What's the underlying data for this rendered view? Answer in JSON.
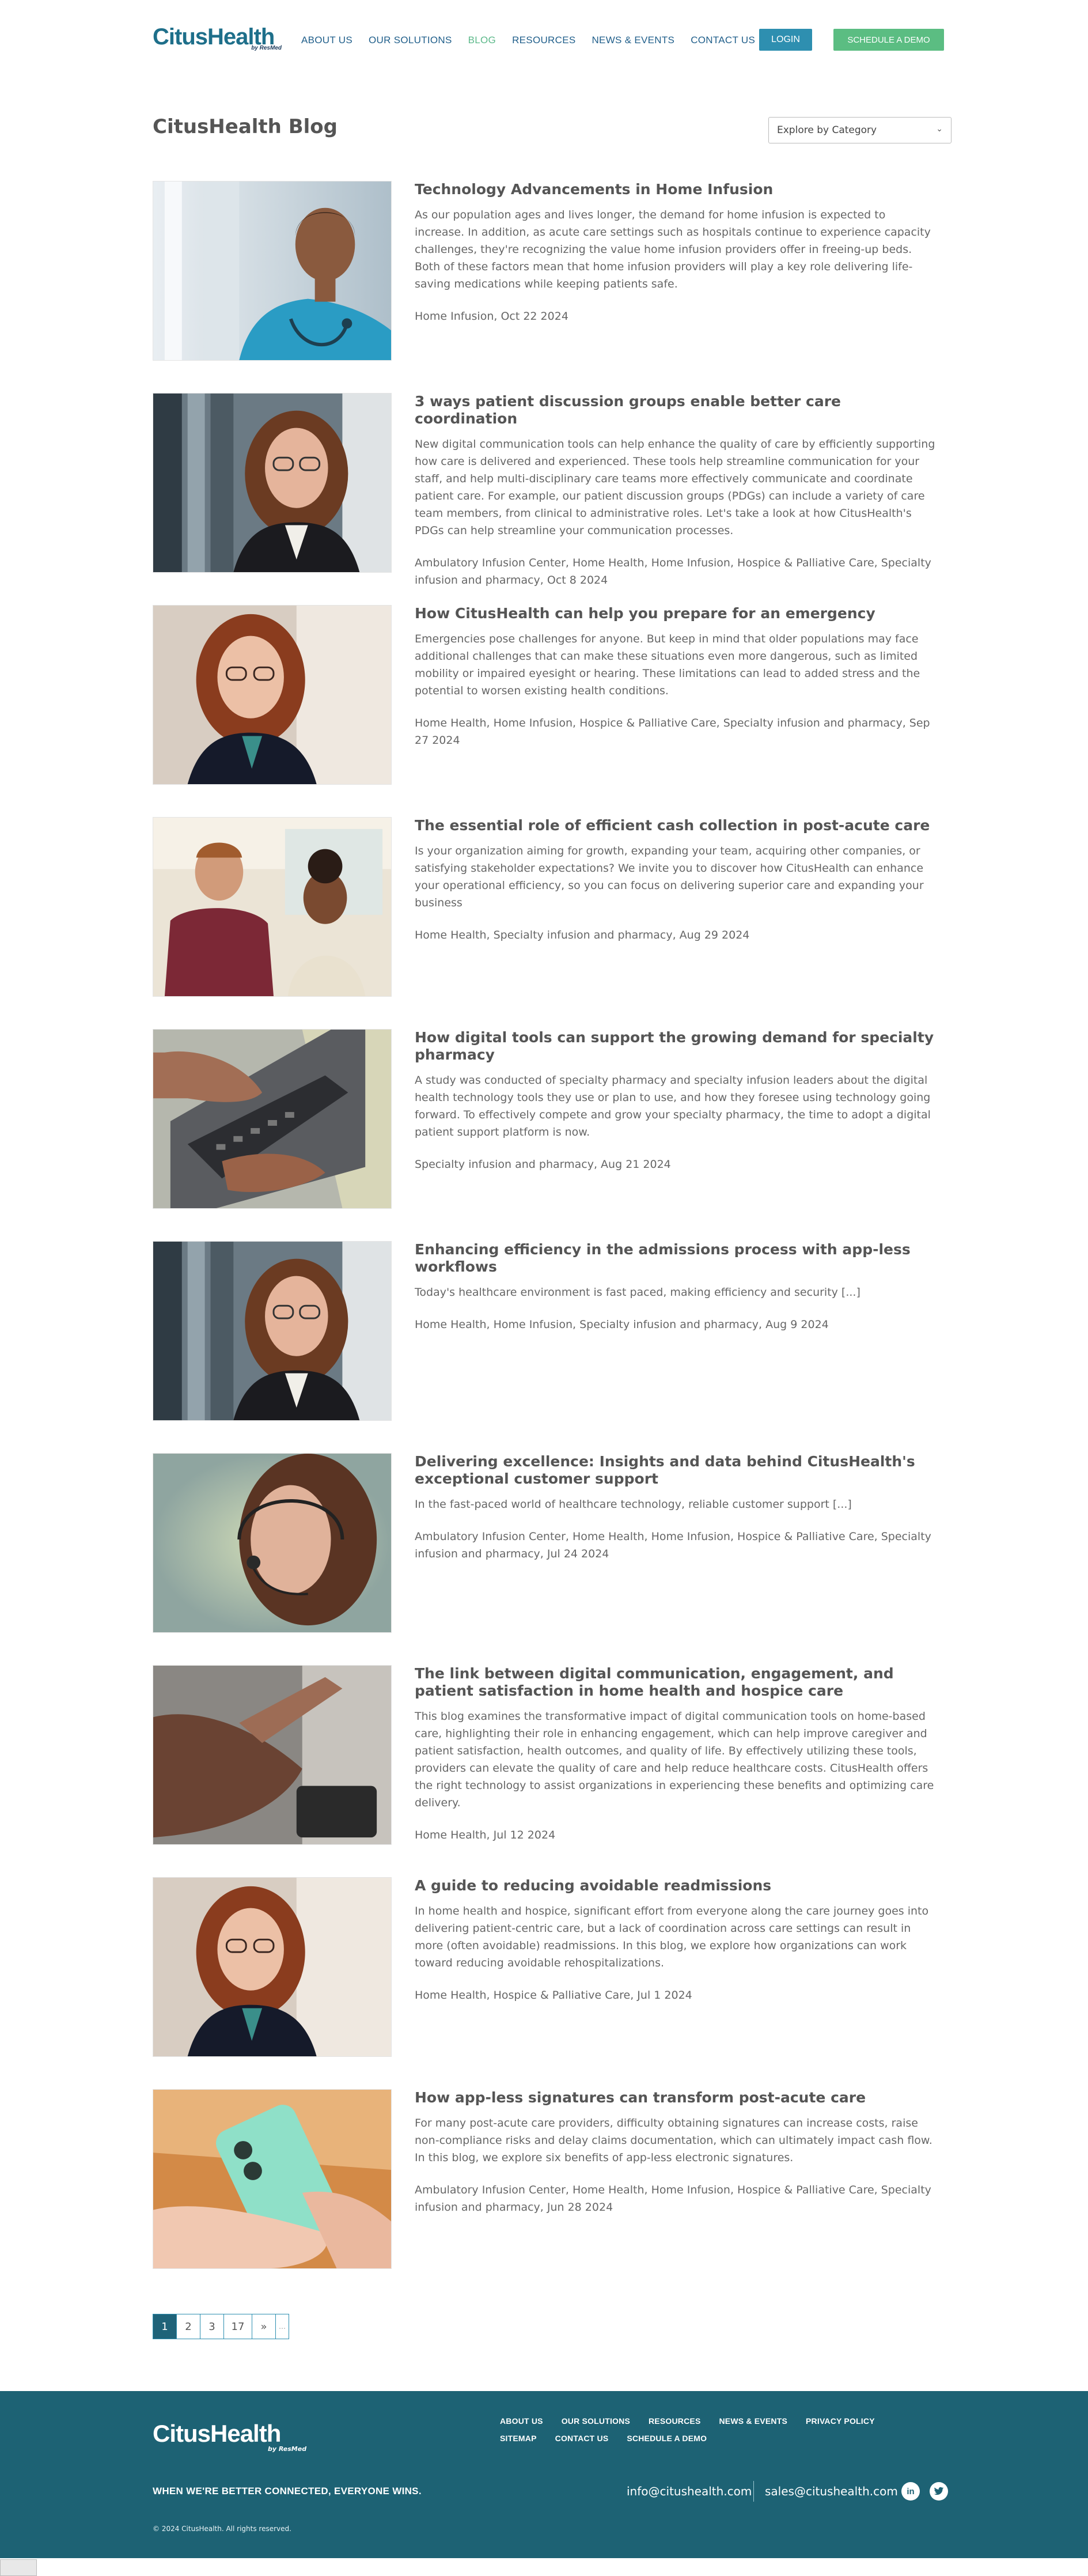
{
  "header": {
    "logo_text": "CitusHealth",
    "logo_byline": "by ResMed",
    "nav": [
      {
        "label": "ABOUT US",
        "active": false
      },
      {
        "label": "OUR SOLUTIONS",
        "active": false
      },
      {
        "label": "BLOG",
        "active": true
      },
      {
        "label": "RESOURCES",
        "active": false
      },
      {
        "label": "NEWS & EVENTS",
        "active": false
      },
      {
        "label": "CONTACT US",
        "active": false
      }
    ],
    "login_label": "LOGIN",
    "demo_label": "SCHEDULE A DEMO"
  },
  "blog": {
    "title": "CitusHealth Blog",
    "category_select": "Explore by Category"
  },
  "posts": [
    {
      "title": "Technology Advancements in Home Infusion",
      "excerpt": "As our population ages and lives longer, the demand for home infusion is expected to increase. In addition, as acute care settings such as hospitals continue to experience capacity challenges, they're recognizing the value home infusion providers offer in freeing-up beds. Both of these factors mean that home infusion providers will play a key role delivering life-saving medications while keeping patients safe.",
      "meta": "Home Infusion, Oct 22 2024",
      "image": "nurse-smiling"
    },
    {
      "title": "3 ways patient discussion groups enable better care coordination",
      "excerpt": "New digital communication tools can help enhance the quality of care by efficiently supporting how care is delivered and experienced. These tools help streamline communication for your staff, and help multi-disciplinary care teams more effectively communicate and coordinate patient care. For example, our  patient discussion groups (PDGs) can include a variety of care team members, from clinical to administrative roles. Let's take a look at how CitusHealth's PDGs can help streamline your communication processes.",
      "meta": "Ambulatory Infusion Center, Home Health, Home Infusion, Hospice & Palliative Care, Specialty infusion and pharmacy, Oct 8 2024",
      "image": "woman-portrait"
    },
    {
      "title": "How CitusHealth can help you prepare for an emergency",
      "excerpt": "Emergencies pose challenges for anyone. But keep in mind that older populations may face additional challenges that can make these situations even more dangerous, such as limited mobility or impaired eyesight or hearing. These limitations can lead to added stress and the potential to worsen existing health conditions.",
      "meta": "Home Health, Home Infusion, Hospice & Palliative Care, Specialty infusion and pharmacy, Sep 27 2024",
      "image": "woman-portrait-red"
    },
    {
      "title": "The essential role of efficient cash collection in post-acute care",
      "excerpt": "Is your organization aiming for growth, expanding your team, acquiring other companies, or satisfying stakeholder expectations? We invite you to discover how CitusHealth can enhance your operational efficiency, so you can focus on delivering superior care and expanding your business",
      "meta": "Home Health, Specialty infusion and pharmacy, Aug 29 2024",
      "image": "meeting"
    },
    {
      "title": "How digital tools can support the growing demand for specialty pharmacy",
      "excerpt": "A study was conducted of specialty pharmacy and specialty infusion leaders about the digital health technology tools they use or plan to use, and how they foresee using technology going forward. To effectively compete and grow your specialty pharmacy, the time to adopt a digital patient support platform is now.",
      "meta": "Specialty infusion and pharmacy, Aug 21 2024",
      "image": "laptop-hands"
    },
    {
      "title": "Enhancing efficiency in the admissions process with app-less workflows",
      "excerpt": "Today's healthcare environment is fast paced, making efficiency and security [...]",
      "meta": "Home Health, Home Infusion, Specialty infusion and pharmacy, Aug 9 2024",
      "image": "woman-portrait"
    },
    {
      "title": "Delivering excellence: Insights and data behind CitusHealth's exceptional customer support",
      "excerpt": "In the fast-paced world of healthcare technology, reliable customer support [...]",
      "meta": "Ambulatory Infusion Center, Home Health, Home Infusion, Hospice & Palliative Care, Specialty infusion and pharmacy, Jul 24 2024",
      "image": "headset-agent"
    },
    {
      "title": "The link between digital communication, engagement, and patient satisfaction in home health and hospice care",
      "excerpt": "This blog examines the transformative impact of digital communication tools on home-based care, highlighting their role in enhancing engagement, which can help improve caregiver and patient satisfaction, health outcomes, and quality of life. By effectively utilizing these tools, providers can elevate the quality of care and help reduce healthcare costs. CitusHealth offers the right technology to assist organizations in experiencing these benefits and optimizing care delivery.",
      "meta": "Home Health, Jul 12 2024",
      "image": "phone-hand"
    },
    {
      "title": "A guide to reducing avoidable readmissions",
      "excerpt": "In home health and hospice, significant effort from everyone along the care journey goes into delivering patient-centric care, but a lack of coordination across care settings can result in more (often avoidable) readmissions. In this blog, we explore how organizations can work toward reducing avoidable rehospitalizations.",
      "meta": "Home Health, Hospice & Palliative Care, Jul 1 2024",
      "image": "woman-portrait-red"
    },
    {
      "title": "How app-less signatures can transform post-acute care",
      "excerpt": "For many post-acute care providers, difficulty obtaining signatures can increase costs, raise non-compliance risks and delay claims documentation, which can ultimately impact cash flow. In this blog, we explore six benefits of app-less electronic signatures.",
      "meta": "Ambulatory Infusion Center, Home Health, Home Infusion, Hospice & Palliative Care, Specialty infusion and pharmacy, Jun 28 2024",
      "image": "phone-mint"
    }
  ],
  "pagination": {
    "pages": [
      "1",
      "2",
      "3",
      "17"
    ],
    "next": "»",
    "ellipsis": "…"
  },
  "footer": {
    "logo_text": "CitusHealth",
    "logo_byline": "by ResMed",
    "nav": [
      "ABOUT US",
      "OUR SOLUTIONS",
      "RESOURCES",
      "NEWS & EVENTS",
      "PRIVACY POLICY",
      "SITEMAP",
      "CONTACT US",
      "SCHEDULE A DEMO"
    ],
    "tagline": "WHEN WE'RE BETTER CONNECTED, EVERYONE WINS.",
    "email_info": "info@citushealth.com",
    "email_sales": "sales@citushealth.com",
    "social": [
      "in",
      "t"
    ],
    "copyright": "© 2024 CitusHealth. All rights reserved."
  },
  "colors": {
    "brand_teal": "#1e6f8a",
    "accent_green": "#5bbd82",
    "login_blue": "#2e8fb0",
    "footer_bg": "#1d6274"
  }
}
